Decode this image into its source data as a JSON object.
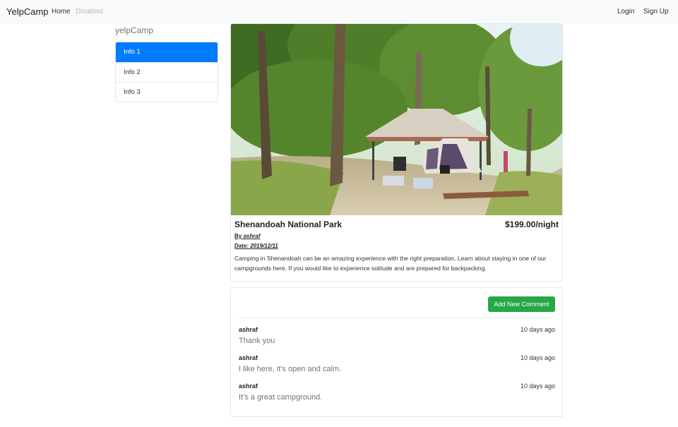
{
  "navbar": {
    "brand": "YelpCamp",
    "home": "Home",
    "disabled": "Disabled",
    "login": "Login",
    "signup": "Sign Up"
  },
  "sidebar": {
    "title": "yelpCamp",
    "items": [
      {
        "label": "Info 1",
        "active": true
      },
      {
        "label": "Info 2",
        "active": false
      },
      {
        "label": "Info 3",
        "active": false
      }
    ]
  },
  "campground": {
    "name": "Shenandoah National Park",
    "price": "$199.00/night",
    "by_label": "By",
    "author": "ashraf",
    "date_label": "Date:",
    "date": "2019/12/11",
    "description": "Camping in Shenandoah can be an amazing experience with the right preparation. Learn about staying in one of our campgrounds here. If you would like to experience solitude and are prepared for backpacking."
  },
  "comments": {
    "add_button": "Add New Comment",
    "items": [
      {
        "author": "ashraf",
        "time": "10 days ago",
        "text": "Thank you"
      },
      {
        "author": "ashraf",
        "time": "10 days ago",
        "text": "I like here, it's open and calm."
      },
      {
        "author": "ashraf",
        "time": "10 days ago",
        "text": "It's a great campground."
      }
    ]
  },
  "colors": {
    "primary": "#007bff",
    "success": "#28a745",
    "navbar_bg": "#f8f9fa"
  }
}
